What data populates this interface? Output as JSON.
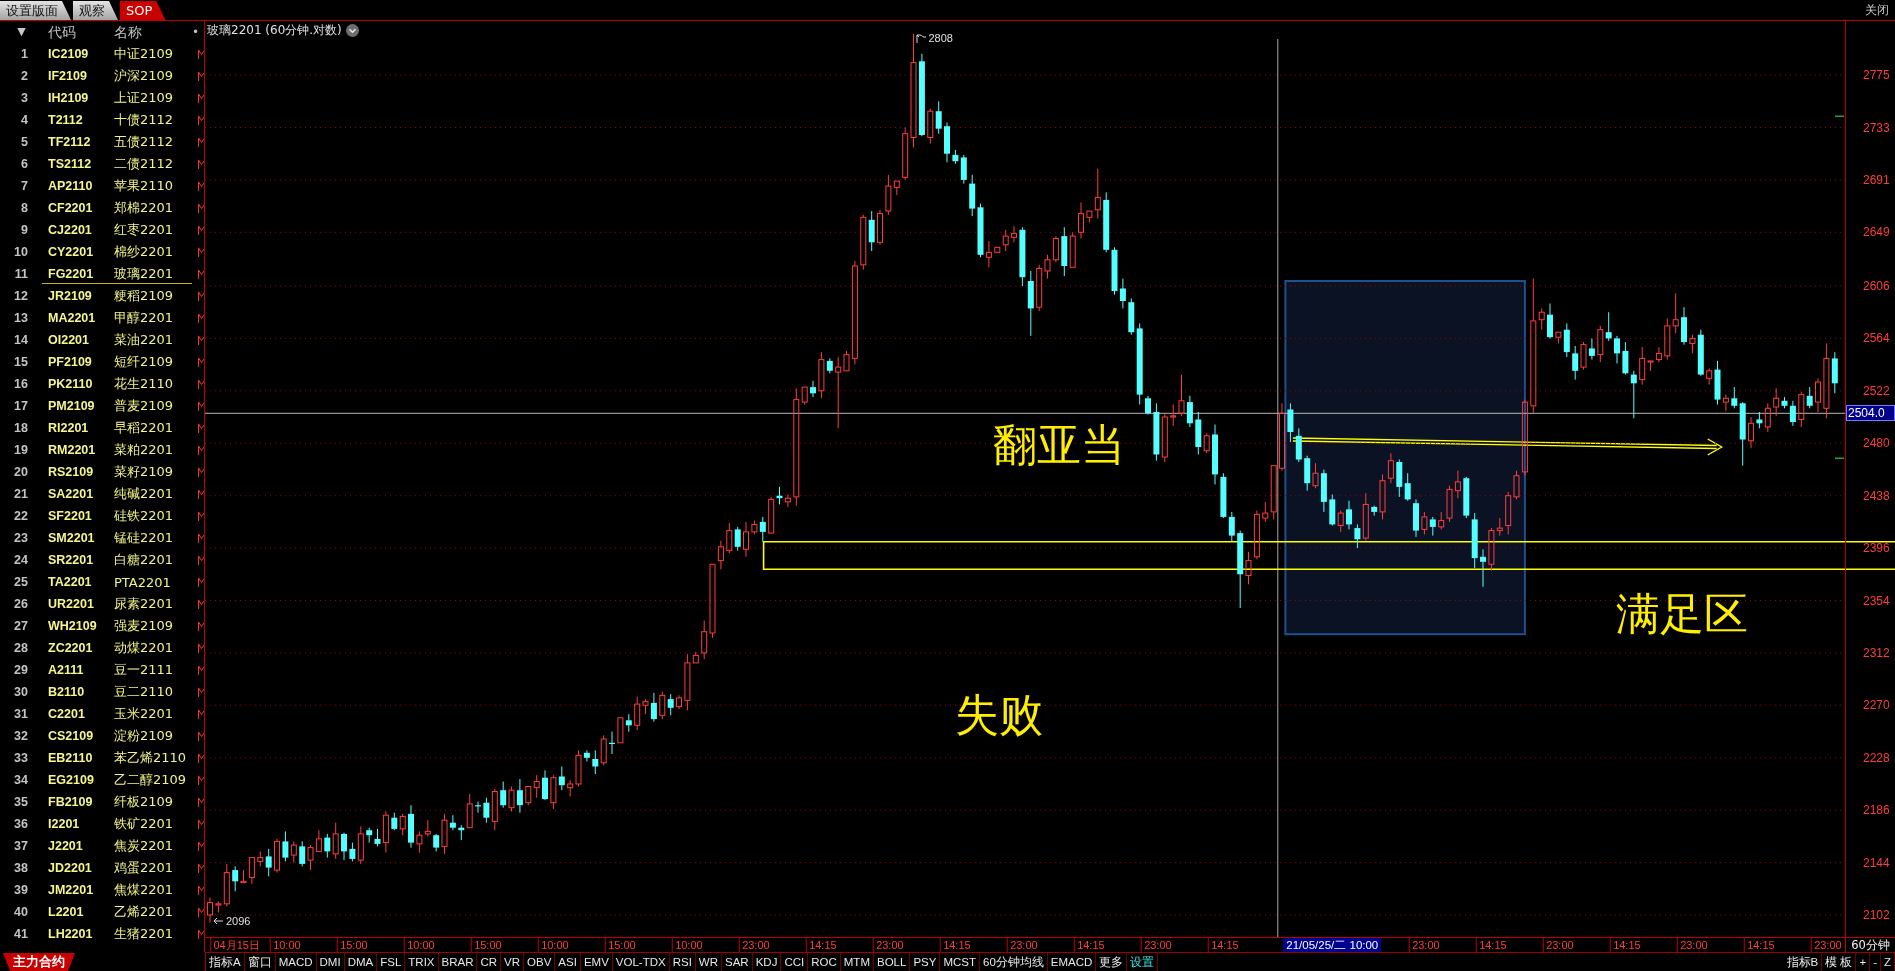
{
  "top_bar": {
    "tabs": [
      {
        "label": "设置版面",
        "selected": false
      },
      {
        "label": "观察",
        "selected": false
      },
      {
        "label": "SOP",
        "selected": true
      }
    ],
    "close": "关闭"
  },
  "sidebar": {
    "header": {
      "sort": "▼",
      "code": "代码",
      "name": "名称",
      "marker": "•"
    },
    "rows": [
      {
        "index": "1",
        "code": "IC2109",
        "name": "中证2109",
        "selected": false
      },
      {
        "index": "2",
        "code": "IF2109",
        "name": "沪深2109",
        "selected": false
      },
      {
        "index": "3",
        "code": "IH2109",
        "name": "上证2109",
        "selected": false
      },
      {
        "index": "4",
        "code": "T2112",
        "name": "十债2112",
        "selected": false
      },
      {
        "index": "5",
        "code": "TF2112",
        "name": "五债2112",
        "selected": false
      },
      {
        "index": "6",
        "code": "TS2112",
        "name": "二债2112",
        "selected": false
      },
      {
        "index": "7",
        "code": "AP2110",
        "name": "苹果2110",
        "selected": false
      },
      {
        "index": "8",
        "code": "CF2201",
        "name": "郑棉2201",
        "selected": false
      },
      {
        "index": "9",
        "code": "CJ2201",
        "name": "红枣2201",
        "selected": false
      },
      {
        "index": "10",
        "code": "CY2201",
        "name": "棉纱2201",
        "selected": false
      },
      {
        "index": "11",
        "code": "FG2201",
        "name": "玻璃2201",
        "selected": true
      },
      {
        "index": "12",
        "code": "JR2109",
        "name": "粳稻2109",
        "selected": false
      },
      {
        "index": "13",
        "code": "MA2201",
        "name": "甲醇2201",
        "selected": false
      },
      {
        "index": "14",
        "code": "OI2201",
        "name": "菜油2201",
        "selected": false
      },
      {
        "index": "15",
        "code": "PF2109",
        "name": "短纤2109",
        "selected": false
      },
      {
        "index": "16",
        "code": "PK2110",
        "name": "花生2110",
        "selected": false
      },
      {
        "index": "17",
        "code": "PM2109",
        "name": "普麦2109",
        "selected": false
      },
      {
        "index": "18",
        "code": "RI2201",
        "name": "早稻2201",
        "selected": false
      },
      {
        "index": "19",
        "code": "RM2201",
        "name": "菜粕2201",
        "selected": false
      },
      {
        "index": "20",
        "code": "RS2109",
        "name": "菜籽2109",
        "selected": false
      },
      {
        "index": "21",
        "code": "SA2201",
        "name": "纯碱2201",
        "selected": false
      },
      {
        "index": "22",
        "code": "SF2201",
        "name": "硅铁2201",
        "selected": false
      },
      {
        "index": "23",
        "code": "SM2201",
        "name": "锰硅2201",
        "selected": false
      },
      {
        "index": "24",
        "code": "SR2201",
        "name": "白糖2201",
        "selected": false
      },
      {
        "index": "25",
        "code": "TA2201",
        "name": "PTA2201",
        "selected": false
      },
      {
        "index": "26",
        "code": "UR2201",
        "name": "尿素2201",
        "selected": false
      },
      {
        "index": "27",
        "code": "WH2109",
        "name": "强麦2109",
        "selected": false
      },
      {
        "index": "28",
        "code": "ZC2201",
        "name": "动煤2201",
        "selected": false
      },
      {
        "index": "29",
        "code": "A2111",
        "name": "豆一2111",
        "selected": false
      },
      {
        "index": "30",
        "code": "B2110",
        "name": "豆二2110",
        "selected": false
      },
      {
        "index": "31",
        "code": "C2201",
        "name": "玉米2201",
        "selected": false
      },
      {
        "index": "32",
        "code": "CS2109",
        "name": "淀粉2109",
        "selected": false
      },
      {
        "index": "33",
        "code": "EB2110",
        "name": "苯乙烯2110",
        "selected": false
      },
      {
        "index": "34",
        "code": "EG2109",
        "name": "乙二醇2109",
        "selected": false
      },
      {
        "index": "35",
        "code": "FB2109",
        "name": "纤板2109",
        "selected": false
      },
      {
        "index": "36",
        "code": "I2201",
        "name": "铁矿2201",
        "selected": false
      },
      {
        "index": "37",
        "code": "J2201",
        "name": "焦炭2201",
        "selected": false
      },
      {
        "index": "38",
        "code": "JD2201",
        "name": "鸡蛋2201",
        "selected": false
      },
      {
        "index": "39",
        "code": "JM2201",
        "name": "焦煤2201",
        "selected": false
      },
      {
        "index": "40",
        "code": "L2201",
        "name": "乙烯2201",
        "selected": false
      },
      {
        "index": "41",
        "code": "LH2201",
        "name": "生猪2201",
        "selected": false
      }
    ],
    "bottom_tab": "主力合约"
  },
  "chart": {
    "chart_data": {
      "type": "candlestick",
      "title": "玻璃2201 (60分钟.对数)",
      "categories": [
        null,
        null,
        null,
        "04月15日",
        null,
        null,
        null,
        null,
        null,
        "10:00",
        null,
        null,
        null,
        null,
        null,
        null,
        null,
        "15:00",
        null,
        null,
        null,
        null,
        null,
        null,
        null,
        "10:00",
        null,
        null,
        null,
        null,
        null,
        null,
        null,
        "15:00",
        null,
        null,
        null,
        null,
        null,
        null,
        null,
        "10:00",
        null,
        null,
        null,
        null,
        null,
        null,
        null,
        "15:00",
        null,
        null,
        null,
        null,
        null,
        null,
        null,
        "10:00",
        null,
        null,
        null,
        null,
        null,
        null,
        null,
        "23:00",
        null,
        null,
        null,
        null,
        null,
        null,
        null,
        "14:15",
        null,
        null,
        null,
        null,
        null,
        null,
        null,
        "23:00",
        null,
        null,
        null,
        null,
        null,
        null,
        null,
        "14:15",
        null,
        null,
        null,
        null,
        null,
        null,
        null,
        "23:00",
        null,
        null,
        null,
        null,
        null,
        null,
        null,
        "14:15",
        null,
        null,
        null,
        null,
        null,
        null,
        null,
        "23:00",
        null,
        null,
        null,
        null,
        null,
        null,
        null,
        "14:15",
        null,
        null,
        null,
        null,
        null,
        null,
        null,
        null,
        null,
        null,
        null,
        null,
        "21/05/25/二 10:00",
        null,
        null,
        null,
        null,
        null,
        null,
        null,
        null,
        null,
        null,
        "23:00",
        null,
        null,
        null,
        null,
        null,
        null,
        null,
        "14:15",
        null,
        null,
        null,
        null,
        null,
        null,
        null,
        "23:00",
        null,
        null,
        null,
        null,
        null,
        null,
        null,
        "14:15",
        null,
        null,
        null,
        null,
        null,
        null,
        null,
        "23:00",
        null,
        null,
        null,
        null,
        null,
        null,
        null,
        "14:15",
        null,
        null,
        null,
        null,
        null,
        null,
        null,
        "23:00",
        null
      ],
      "ohlc": [
        [
          2102,
          2116,
          2096,
          2112
        ],
        [
          2110,
          2113,
          2104,
          2111
        ],
        [
          2111,
          2143,
          2109,
          2136
        ],
        [
          2138,
          2141,
          2121,
          2129
        ],
        [
          2128,
          2138,
          2127,
          2129
        ],
        [
          2132,
          2149,
          2127,
          2148
        ],
        [
          2145,
          2153,
          2141,
          2148
        ],
        [
          2149,
          2155,
          2133,
          2140
        ],
        [
          2138,
          2163,
          2136,
          2161
        ],
        [
          2161,
          2169,
          2145,
          2148
        ],
        [
          2150,
          2161,
          2144,
          2158
        ],
        [
          2157,
          2161,
          2141,
          2143
        ],
        [
          2146,
          2158,
          2138,
          2156
        ],
        [
          2153,
          2170,
          2152,
          2163
        ],
        [
          2164,
          2167,
          2148,
          2153
        ],
        [
          2151,
          2176,
          2147,
          2167
        ],
        [
          2167,
          2168,
          2146,
          2153
        ],
        [
          2155,
          2160,
          2145,
          2147
        ],
        [
          2146,
          2173,
          2143,
          2167
        ],
        [
          2170,
          2172,
          2160,
          2166
        ],
        [
          2163,
          2171,
          2157,
          2159
        ],
        [
          2160,
          2185,
          2152,
          2182
        ],
        [
          2180,
          2184,
          2170,
          2171
        ],
        [
          2171,
          2183,
          2166,
          2181
        ],
        [
          2183,
          2190,
          2156,
          2160
        ],
        [
          2159,
          2169,
          2152,
          2166
        ],
        [
          2167,
          2178,
          2165,
          2169
        ],
        [
          2166,
          2167,
          2153,
          2156
        ],
        [
          2157,
          2183,
          2151,
          2178
        ],
        [
          2176,
          2182,
          2170,
          2172
        ],
        [
          2172,
          2174,
          2162,
          2170
        ],
        [
          2172,
          2199,
          2171,
          2191
        ],
        [
          2190,
          2193,
          2184,
          2189
        ],
        [
          2192,
          2196,
          2176,
          2180
        ],
        [
          2177,
          2203,
          2170,
          2201
        ],
        [
          2202,
          2209,
          2188,
          2190
        ],
        [
          2188,
          2205,
          2185,
          2202
        ],
        [
          2202,
          2211,
          2184,
          2190
        ],
        [
          2192,
          2206,
          2190,
          2205
        ],
        [
          2204,
          2214,
          2196,
          2209
        ],
        [
          2212,
          2218,
          2194,
          2195
        ],
        [
          2192,
          2214,
          2187,
          2212
        ],
        [
          2213,
          2221,
          2202,
          2206
        ],
        [
          2204,
          2210,
          2197,
          2207
        ],
        [
          2207,
          2234,
          2205,
          2230
        ],
        [
          2232,
          2234,
          2225,
          2228
        ],
        [
          2227,
          2234,
          2215,
          2221
        ],
        [
          2224,
          2246,
          2222,
          2243
        ],
        [
          2240,
          2249,
          2231,
          2239
        ],
        [
          2240,
          2261,
          2239,
          2260
        ],
        [
          2258,
          2263,
          2249,
          2254
        ],
        [
          2254,
          2277,
          2250,
          2271
        ],
        [
          2270,
          2275,
          2263,
          2273
        ],
        [
          2272,
          2280,
          2257,
          2259
        ],
        [
          2262,
          2281,
          2259,
          2278
        ],
        [
          2275,
          2279,
          2262,
          2268
        ],
        [
          2269,
          2278,
          2267,
          2276
        ],
        [
          2274,
          2311,
          2266,
          2304
        ],
        [
          2304,
          2313,
          2303,
          2310
        ],
        [
          2312,
          2338,
          2307,
          2329
        ],
        [
          2328,
          2384,
          2324,
          2383
        ],
        [
          2386,
          2402,
          2379,
          2397
        ],
        [
          2394,
          2416,
          2392,
          2410
        ],
        [
          2411,
          2413,
          2394,
          2397
        ],
        [
          2395,
          2417,
          2389,
          2409
        ],
        [
          2409,
          2418,
          2407,
          2415
        ],
        [
          2417,
          2421,
          2401,
          2409
        ],
        [
          2408,
          2437,
          2407,
          2435
        ],
        [
          2438,
          2445,
          2431,
          2436
        ],
        [
          2433,
          2439,
          2429,
          2436
        ],
        [
          2437,
          2524,
          2430,
          2515
        ],
        [
          2513,
          2526,
          2511,
          2525
        ],
        [
          2525,
          2530,
          2517,
          2520
        ],
        [
          2522,
          2553,
          2516,
          2547
        ],
        [
          2546,
          2548,
          2536,
          2538
        ],
        [
          2537,
          2549,
          2492,
          2541
        ],
        [
          2538,
          2554,
          2537,
          2551
        ],
        [
          2548,
          2626,
          2543,
          2622
        ],
        [
          2623,
          2663,
          2619,
          2661
        ],
        [
          2659,
          2666,
          2634,
          2641
        ],
        [
          2641,
          2667,
          2639,
          2664
        ],
        [
          2666,
          2695,
          2663,
          2686
        ],
        [
          2685,
          2691,
          2679,
          2690
        ],
        [
          2693,
          2733,
          2691,
          2728
        ],
        [
          2725,
          2808,
          2717,
          2785
        ],
        [
          2786,
          2792,
          2726,
          2727
        ],
        [
          2725,
          2748,
          2720,
          2746
        ],
        [
          2746,
          2754,
          2728,
          2732
        ],
        [
          2734,
          2737,
          2705,
          2712
        ],
        [
          2711,
          2715,
          2704,
          2706
        ],
        [
          2709,
          2711,
          2688,
          2691
        ],
        [
          2688,
          2695,
          2662,
          2668
        ],
        [
          2669,
          2672,
          2629,
          2631
        ],
        [
          2629,
          2642,
          2621,
          2633
        ],
        [
          2633,
          2638,
          2632,
          2637
        ],
        [
          2639,
          2651,
          2634,
          2646
        ],
        [
          2645,
          2654,
          2641,
          2648
        ],
        [
          2651,
          2653,
          2606,
          2613
        ],
        [
          2610,
          2618,
          2566,
          2588
        ],
        [
          2589,
          2623,
          2586,
          2620
        ],
        [
          2618,
          2631,
          2612,
          2627
        ],
        [
          2627,
          2646,
          2625,
          2644
        ],
        [
          2646,
          2653,
          2614,
          2622
        ],
        [
          2621,
          2649,
          2620,
          2646
        ],
        [
          2649,
          2673,
          2644,
          2664
        ],
        [
          2661,
          2667,
          2657,
          2666
        ],
        [
          2667,
          2700,
          2660,
          2677
        ],
        [
          2675,
          2681,
          2633,
          2635
        ],
        [
          2635,
          2637,
          2599,
          2602
        ],
        [
          2604,
          2612,
          2588,
          2594
        ],
        [
          2593,
          2596,
          2567,
          2569
        ],
        [
          2572,
          2576,
          2511,
          2519
        ],
        [
          2516,
          2518,
          2503,
          2504
        ],
        [
          2505,
          2512,
          2466,
          2471
        ],
        [
          2469,
          2504,
          2465,
          2501
        ],
        [
          2501,
          2511,
          2494,
          2502
        ],
        [
          2504,
          2535,
          2502,
          2514
        ],
        [
          2513,
          2518,
          2493,
          2496
        ],
        [
          2499,
          2505,
          2471,
          2477
        ],
        [
          2474,
          2488,
          2472,
          2486
        ],
        [
          2487,
          2495,
          2447,
          2455
        ],
        [
          2453,
          2456,
          2420,
          2421
        ],
        [
          2421,
          2425,
          2401,
          2406
        ],
        [
          2408,
          2410,
          2348,
          2375
        ],
        [
          2374,
          2393,
          2367,
          2386
        ],
        [
          2389,
          2426,
          2387,
          2423
        ],
        [
          2420,
          2433,
          2417,
          2424
        ],
        [
          2425,
          2463,
          2419,
          2462
        ],
        [
          2460,
          2512,
          2458,
          2504
        ],
        [
          2507,
          2512,
          2481,
          2489
        ],
        [
          2486,
          2492,
          2465,
          2467
        ],
        [
          2468,
          2470,
          2442,
          2448
        ],
        [
          2446,
          2464,
          2444,
          2456
        ],
        [
          2456,
          2459,
          2425,
          2433
        ],
        [
          2435,
          2439,
          2414,
          2415
        ],
        [
          2414,
          2426,
          2409,
          2424
        ],
        [
          2427,
          2434,
          2411,
          2415
        ],
        [
          2412,
          2415,
          2396,
          2403
        ],
        [
          2404,
          2440,
          2402,
          2431
        ],
        [
          2429,
          2430,
          2422,
          2425
        ],
        [
          2425,
          2455,
          2419,
          2450
        ],
        [
          2452,
          2472,
          2448,
          2466
        ],
        [
          2465,
          2467,
          2437,
          2445
        ],
        [
          2448,
          2456,
          2434,
          2435
        ],
        [
          2432,
          2435,
          2405,
          2410
        ],
        [
          2411,
          2425,
          2407,
          2421
        ],
        [
          2419,
          2421,
          2406,
          2413
        ],
        [
          2413,
          2425,
          2411,
          2418
        ],
        [
          2420,
          2446,
          2417,
          2443
        ],
        [
          2442,
          2458,
          2436,
          2449
        ],
        [
          2452,
          2453,
          2420,
          2422
        ],
        [
          2419,
          2424,
          2380,
          2388
        ],
        [
          2389,
          2395,
          2365,
          2385
        ],
        [
          2383,
          2412,
          2378,
          2410
        ],
        [
          2410,
          2420,
          2406,
          2412
        ],
        [
          2414,
          2441,
          2407,
          2438
        ],
        [
          2437,
          2458,
          2435,
          2454
        ],
        [
          2457,
          2515,
          2454,
          2513
        ],
        [
          2510,
          2612,
          2504,
          2578
        ],
        [
          2579,
          2588,
          2571,
          2585
        ],
        [
          2583,
          2592,
          2564,
          2565
        ],
        [
          2565,
          2570,
          2560,
          2569
        ],
        [
          2571,
          2576,
          2549,
          2553
        ],
        [
          2552,
          2558,
          2531,
          2538
        ],
        [
          2541,
          2561,
          2539,
          2559
        ],
        [
          2556,
          2564,
          2547,
          2550
        ],
        [
          2551,
          2574,
          2545,
          2571
        ],
        [
          2569,
          2585,
          2562,
          2564
        ],
        [
          2564,
          2566,
          2544,
          2552
        ],
        [
          2554,
          2561,
          2535,
          2536
        ],
        [
          2535,
          2538,
          2500,
          2528
        ],
        [
          2531,
          2557,
          2527,
          2548
        ],
        [
          2545,
          2547,
          2538,
          2546
        ],
        [
          2547,
          2557,
          2545,
          2552
        ],
        [
          2550,
          2580,
          2547,
          2574
        ],
        [
          2574,
          2600,
          2568,
          2579
        ],
        [
          2581,
          2589,
          2559,
          2561
        ],
        [
          2560,
          2567,
          2552,
          2564
        ],
        [
          2567,
          2571,
          2534,
          2535
        ],
        [
          2532,
          2540,
          2527,
          2538
        ],
        [
          2539,
          2546,
          2511,
          2515
        ],
        [
          2513,
          2519,
          2506,
          2516
        ],
        [
          2516,
          2525,
          2508,
          2510
        ],
        [
          2512,
          2513,
          2462,
          2483
        ],
        [
          2482,
          2501,
          2476,
          2496
        ],
        [
          2499,
          2505,
          2492,
          2496
        ],
        [
          2493,
          2512,
          2489,
          2508
        ],
        [
          2509,
          2524,
          2502,
          2516
        ],
        [
          2514,
          2517,
          2508,
          2510
        ],
        [
          2510,
          2514,
          2494,
          2497
        ],
        [
          2499,
          2521,
          2493,
          2519
        ],
        [
          2518,
          2525,
          2508,
          2510
        ],
        [
          2513,
          2532,
          2505,
          2529
        ],
        [
          2508,
          2560,
          2500,
          2548
        ],
        [
          2548,
          2553,
          2520,
          2528
        ]
      ],
      "ylim": [
        2084.4,
        2818.3
      ],
      "grid": true,
      "yticks": [
        2775,
        2733,
        2691,
        2649,
        2606,
        2564,
        2522,
        2480,
        2438,
        2396,
        2354,
        2312,
        2270,
        2228,
        2186,
        2144,
        2102
      ]
    },
    "high_label": "2808",
    "low_label": "2096",
    "cursor_price": "2504.0",
    "annotations": [
      "翻亚当",
      "满足区",
      "失败"
    ],
    "period": "60分钟"
  },
  "toolbar": {
    "left": [
      {
        "label": "指标A",
        "kind": "button"
      },
      {
        "label": "窗口",
        "kind": "button"
      },
      {
        "label": "MACD",
        "kind": "button"
      },
      {
        "label": "DMI",
        "kind": "button"
      },
      {
        "label": "DMA",
        "kind": "button"
      },
      {
        "label": "FSL",
        "kind": "button"
      },
      {
        "label": "TRIX",
        "kind": "button"
      },
      {
        "label": "BRAR",
        "kind": "button"
      },
      {
        "label": "CR",
        "kind": "button"
      },
      {
        "label": "VR",
        "kind": "button"
      },
      {
        "label": "OBV",
        "kind": "button"
      },
      {
        "label": "ASI",
        "kind": "button"
      },
      {
        "label": "EMV",
        "kind": "button"
      },
      {
        "label": "VOL-TDX",
        "kind": "button"
      },
      {
        "label": "RSI",
        "kind": "button"
      },
      {
        "label": "WR",
        "kind": "button"
      },
      {
        "label": "SAR",
        "kind": "button"
      },
      {
        "label": "KDJ",
        "kind": "button"
      },
      {
        "label": "CCI",
        "kind": "button"
      },
      {
        "label": "ROC",
        "kind": "button"
      },
      {
        "label": "MTM",
        "kind": "button"
      },
      {
        "label": "BOLL",
        "kind": "button"
      },
      {
        "label": "PSY",
        "kind": "button"
      },
      {
        "label": "MCST",
        "kind": "button"
      },
      {
        "label": "60分钟均线",
        "kind": "button"
      },
      {
        "label": "EMACD",
        "kind": "button"
      },
      {
        "label": "更多",
        "kind": "button"
      },
      {
        "label": "设置",
        "kind": "link"
      }
    ],
    "right": [
      "指标B",
      "模 板",
      "+",
      "-",
      "Z"
    ]
  }
}
